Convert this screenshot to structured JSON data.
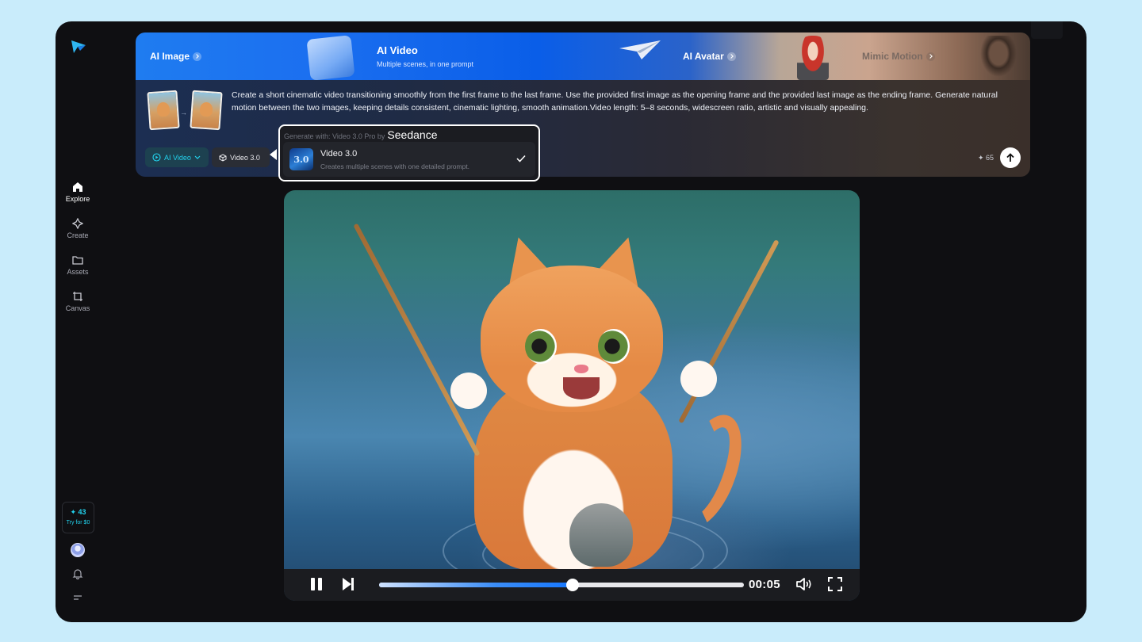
{
  "sidebar": {
    "nav": [
      {
        "label": "Explore",
        "icon": "home-icon",
        "active": true
      },
      {
        "label": "Create",
        "icon": "sparkle-icon"
      },
      {
        "label": "Assets",
        "icon": "folder-icon"
      },
      {
        "label": "Canvas",
        "icon": "crop-icon"
      }
    ],
    "credits": "✦ 43",
    "try_label": "Try for $0"
  },
  "banner": {
    "tabs": [
      {
        "label": "AI Image"
      },
      {
        "label": "AI Video",
        "subtitle": "Multiple scenes, in one prompt"
      },
      {
        "label": "AI Avatar"
      },
      {
        "label": "Mimic Motion"
      }
    ]
  },
  "prompt": {
    "text": "Create a short cinematic video transitioning smoothly from the first frame to the last frame. Use the provided first image as the opening frame and the provided last image as the ending frame. Generate natural motion between the two images, keeping details consistent, cinematic lighting, smooth animation.Video length: 5–8 seconds, widescreen ratio, artistic and visually appealing.",
    "mode_chip": "AI Video",
    "model_chip": "Video 3.0",
    "credit_cost": "✦ 65"
  },
  "dropdown": {
    "header": "Generate with: Video 3.0 Pro by",
    "brand": "Seedance",
    "option": {
      "icon_text": "3.0",
      "title": "Video 3.0",
      "description": "Creates multiple scenes with one detailed prompt."
    }
  },
  "player": {
    "time": "00:05",
    "progress": 0.53
  },
  "colors": {
    "accent": "#22d3ee",
    "progress_blue": "#1677ff",
    "background": "#c9ecfb"
  }
}
